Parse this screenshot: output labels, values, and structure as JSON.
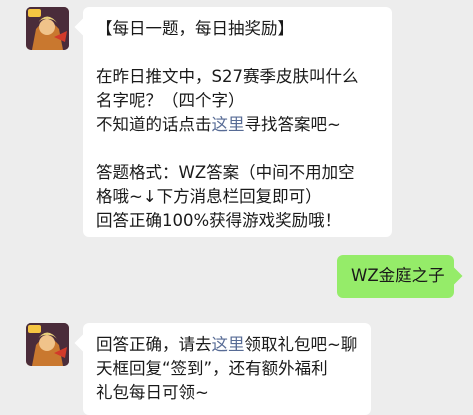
{
  "messages": [
    {
      "sender": "official",
      "avatar_icon": "game-character-avatar-icon",
      "title": "【每日一题，每日抽奖励】",
      "question_line1": "在昨日推文中，S27赛季皮肤叫什么",
      "question_line2": "名字呢？（四个字）",
      "hint_prefix": "不知道的话点击",
      "hint_link": "这里",
      "hint_suffix": "寻找答案吧~",
      "format_line1": "答题格式：WZ答案（中间不用加空",
      "format_line2": "格哦~↓下方消息栏回复即可）",
      "reward_line": "回答正确100%获得游戏奖励哦！"
    },
    {
      "sender": "user",
      "text": "WZ金庭之子"
    },
    {
      "sender": "official",
      "avatar_icon": "game-character-avatar-icon",
      "line1_prefix": "回答正确，请去",
      "line1_link": "这里",
      "line1_suffix": "领取礼包吧~聊",
      "line2": "天框回复“签到”，还有额外福利",
      "line3": "礼包每日可领~"
    }
  ],
  "colors": {
    "background": "#ededed",
    "incoming_bubble": "#ffffff",
    "outgoing_bubble": "#95ec69",
    "link": "#576b95"
  }
}
